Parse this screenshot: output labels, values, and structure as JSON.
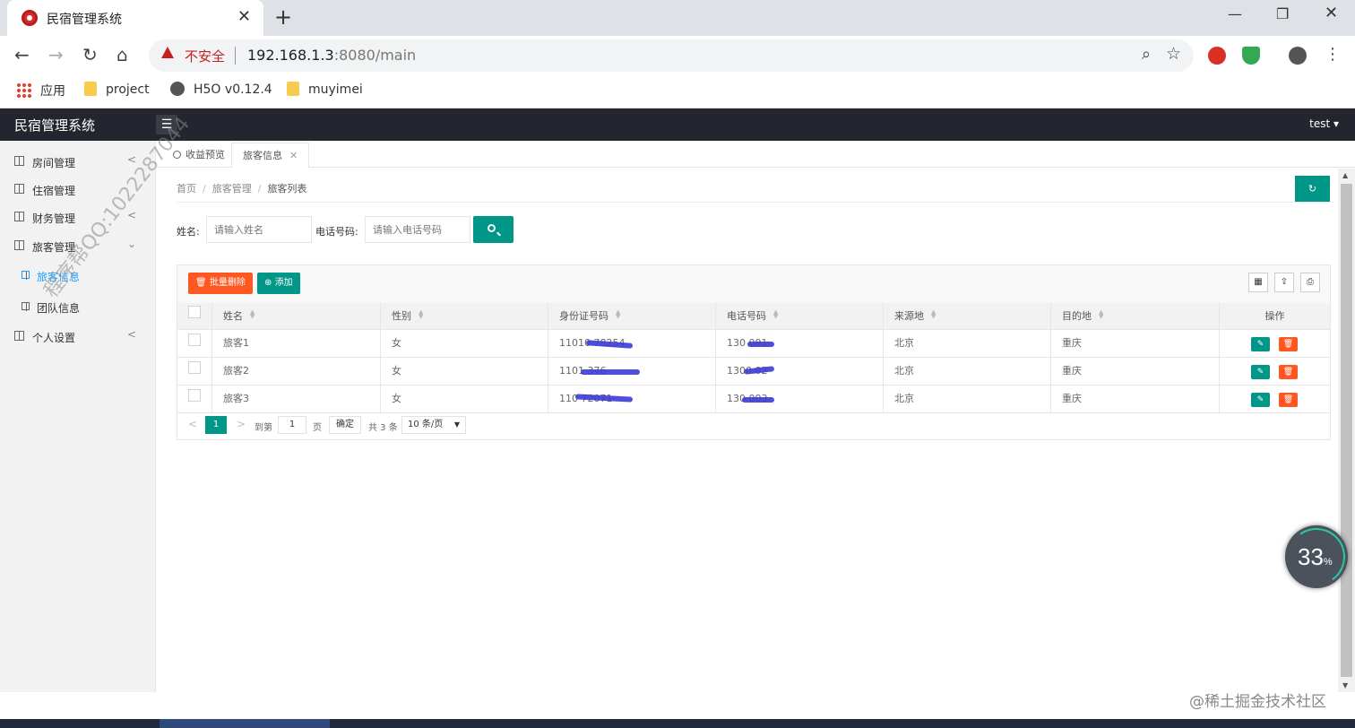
{
  "browser": {
    "tab_title": "民宿管理系统",
    "close_glyph": "✕",
    "new_tab_glyph": "+",
    "url_warning": "不安全",
    "url_host": "192.168.1.3",
    "url_path": ":8080/main",
    "bookmarks": [
      "应用",
      "project",
      "H5O v0.12.4",
      "muyimei"
    ]
  },
  "app": {
    "logo": "民宿管理系统",
    "user": "test ▾",
    "menu_glyph": "☰"
  },
  "sidebar": {
    "items": [
      {
        "label": "房间管理",
        "arrow": "<"
      },
      {
        "label": "住宿管理",
        "arrow": ""
      },
      {
        "label": "财务管理",
        "arrow": "<"
      },
      {
        "label": "旅客管理",
        "arrow": "⌄"
      },
      {
        "label": "旅客信息",
        "arrow": ""
      },
      {
        "label": "团队信息",
        "arrow": ""
      },
      {
        "label": "个人设置",
        "arrow": "<"
      }
    ]
  },
  "watermark": "程序帮QQ:1022287044",
  "page_tabs": [
    {
      "label": "收益预览"
    },
    {
      "label": "旅客信息",
      "close": "✕"
    }
  ],
  "breadcrumb": [
    "首页",
    "旅客管理",
    "旅客列表"
  ],
  "breadcrumb_sep": "/",
  "refresh_glyph": "↻",
  "search": {
    "name_label": "姓名:",
    "name_placeholder": "请输入姓名",
    "phone_label": "电话号码:",
    "phone_placeholder": "请输入电话号码"
  },
  "toolbar": {
    "batch_delete": "批量删除",
    "add": "添加"
  },
  "table": {
    "columns": [
      "姓名",
      "性别",
      "身份证号码",
      "电话号码",
      "来源地",
      "目的地",
      "操作"
    ],
    "rows": [
      {
        "name": "旅客1",
        "gender": "女",
        "id_no": "11010          78254",
        "phone": "130          001",
        "from": "北京",
        "to": "重庆"
      },
      {
        "name": "旅客2",
        "gender": "女",
        "id_no": "1101                376",
        "phone": "1300          02",
        "from": "北京",
        "to": "重庆"
      },
      {
        "name": "旅客3",
        "gender": "女",
        "id_no": "110              72071",
        "phone": "130          003",
        "from": "北京",
        "to": "重庆"
      }
    ]
  },
  "pager": {
    "current": "1",
    "goto_label": "到第",
    "goto_value": "1",
    "page_label": "页",
    "ok": "确定",
    "total": "共 3 条",
    "limit": "10 条/页"
  },
  "speed_widget": {
    "value": "33",
    "unit": "%"
  },
  "footer_watermark": "@稀土掘金技术社区",
  "colors": {
    "primary": "#009688",
    "danger": "#ff5722",
    "header": "#23262e"
  }
}
